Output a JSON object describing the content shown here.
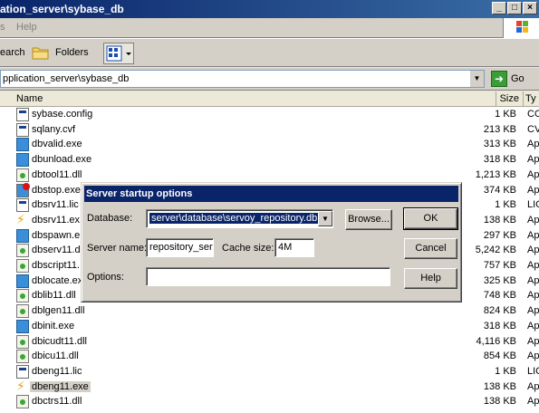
{
  "window": {
    "title": "ation_server\\sybase_db"
  },
  "menu": {
    "items": [
      "s",
      "Help"
    ]
  },
  "toolbar": {
    "search_label": "earch",
    "folders_label": "Folders"
  },
  "address": {
    "path": "pplication_server\\sybase_db",
    "go_label": "Go"
  },
  "columns": {
    "name": "Name",
    "size": "Size",
    "type": "Ty"
  },
  "files": [
    {
      "name": "sybase.config",
      "size": "1 KB",
      "type": "CO",
      "icon": "config-file-icon"
    },
    {
      "name": "sqlany.cvf",
      "size": "213 KB",
      "type": "CV",
      "icon": "config-file-icon"
    },
    {
      "name": "dbvalid.exe",
      "size": "313 KB",
      "type": "Ap",
      "icon": "exe-icon"
    },
    {
      "name": "dbunload.exe",
      "size": "318 KB",
      "type": "Ap",
      "icon": "exe-icon"
    },
    {
      "name": "dbtool11.dll",
      "size": "1,213 KB",
      "type": "Ap",
      "icon": "dll-icon"
    },
    {
      "name": "dbstop.exe",
      "size": "374 KB",
      "type": "Ap",
      "icon": "stop-exe-icon"
    },
    {
      "name": "dbsrv11.lic",
      "size": "1 KB",
      "type": "LIC",
      "icon": "config-file-icon"
    },
    {
      "name": "dbsrv11.ex",
      "size": "138 KB",
      "type": "Ap",
      "icon": "lightning-icon"
    },
    {
      "name": "dbspawn.e",
      "size": "297 KB",
      "type": "Ap",
      "icon": "exe-icon"
    },
    {
      "name": "dbserv11.d",
      "size": "5,242 KB",
      "type": "Ap",
      "icon": "dll-icon"
    },
    {
      "name": "dbscript11.",
      "size": "757 KB",
      "type": "Ap",
      "icon": "dll-icon"
    },
    {
      "name": "dblocate.ex",
      "size": "325 KB",
      "type": "Ap",
      "icon": "exe-icon"
    },
    {
      "name": "dblib11.dll",
      "size": "748 KB",
      "type": "Ap",
      "icon": "dll-icon"
    },
    {
      "name": "dblgen11.dll",
      "size": "824 KB",
      "type": "Ap",
      "icon": "dll-icon"
    },
    {
      "name": "dbinit.exe",
      "size": "318 KB",
      "type": "Ap",
      "icon": "exe-icon"
    },
    {
      "name": "dbicudt11.dll",
      "size": "4,116 KB",
      "type": "Ap",
      "icon": "dll-icon"
    },
    {
      "name": "dbicu11.dll",
      "size": "854 KB",
      "type": "Ap",
      "icon": "dll-icon"
    },
    {
      "name": "dbeng11.lic",
      "size": "1 KB",
      "type": "LIC",
      "icon": "config-file-icon"
    },
    {
      "name": "dbeng11.exe",
      "size": "138 KB",
      "type": "Ap",
      "icon": "lightning-icon",
      "selected": true
    },
    {
      "name": "dbctrs11.dll",
      "size": "138 KB",
      "type": "Ap",
      "icon": "dll-icon"
    }
  ],
  "dialog": {
    "title": "Server startup options",
    "database_label": "Database:",
    "database_value": "server\\database\\servoy_repository.db",
    "browse_label": "Browse...",
    "ok_label": "OK",
    "server_name_label": "Server name:",
    "server_name_value": "repository_ser",
    "cache_size_label": "Cache size:",
    "cache_size_value": "4M",
    "cancel_label": "Cancel",
    "options_label": "Options:",
    "options_value": "",
    "help_label": "Help"
  }
}
